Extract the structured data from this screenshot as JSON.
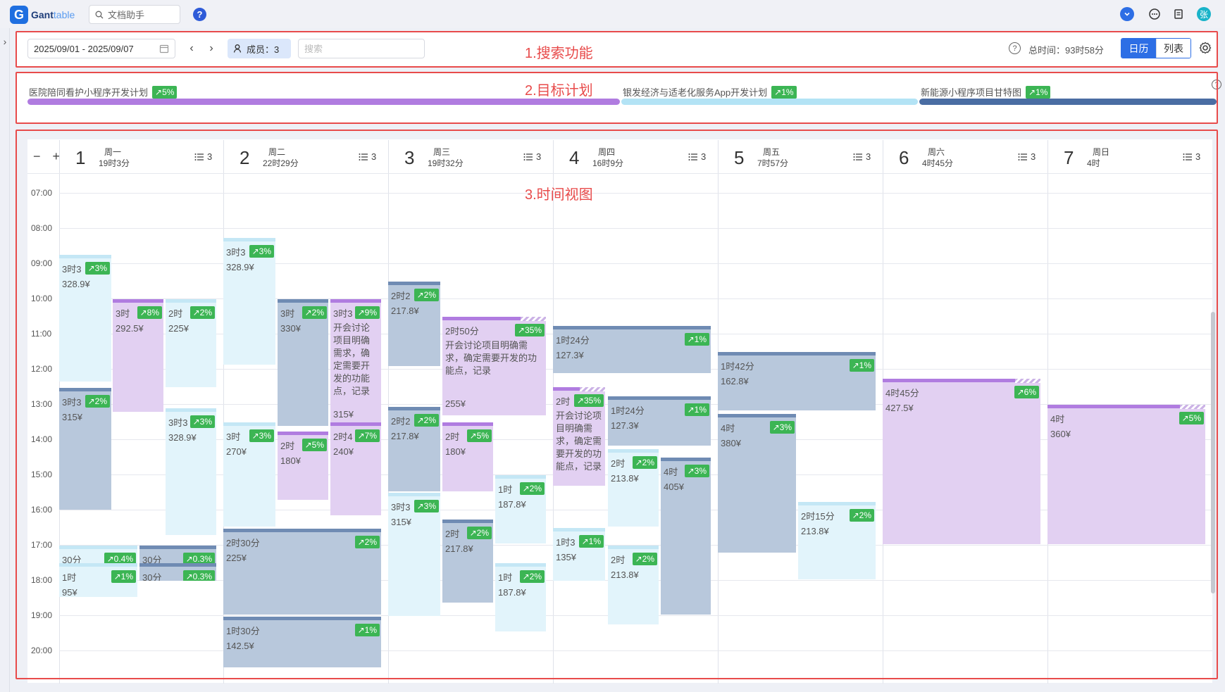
{
  "app": {
    "logo_letter": "G",
    "logo_name_a": "Gant",
    "logo_name_b": "table",
    "doc_search": "文档助手",
    "help": "?",
    "avatar": "张"
  },
  "toolbar": {
    "date_range": "2025/09/01 - 2025/09/07",
    "members_label": "成员：3",
    "search_placeholder": "搜索",
    "total_time": "总时间：93时58分",
    "view_calendar": "日历",
    "view_list": "列表"
  },
  "annotations": {
    "search": "1.搜索功能",
    "goals": "2.目标计划",
    "timeview": "3.时间视图"
  },
  "goals": [
    {
      "name": "医院陪同看护小程序开发计划",
      "pct": "↗5%",
      "color": "#b07ce0"
    },
    {
      "name": "银发经济与适老化服务App开发计划",
      "pct": "↗1%",
      "color": "#b3e3f5"
    },
    {
      "name": "新能源小程序项目甘特图",
      "pct": "↗1%",
      "color": "#4a6da3"
    }
  ],
  "zoom": "− +",
  "days": [
    {
      "num": "1",
      "week": "周一",
      "dur": "19时3分",
      "count": "3"
    },
    {
      "num": "2",
      "week": "周二",
      "dur": "22时29分",
      "count": "3"
    },
    {
      "num": "3",
      "week": "周三",
      "dur": "19时32分",
      "count": "3"
    },
    {
      "num": "4",
      "week": "周四",
      "dur": "16时9分",
      "count": "3"
    },
    {
      "num": "5",
      "week": "周五",
      "dur": "7时57分",
      "count": "3"
    },
    {
      "num": "6",
      "week": "周六",
      "dur": "4时45分",
      "count": "3"
    },
    {
      "num": "7",
      "week": "周日",
      "dur": "4时",
      "count": "3"
    }
  ],
  "hours": [
    "07:00",
    "08:00",
    "09:00",
    "10:00",
    "11:00",
    "12:00",
    "13:00",
    "14:00",
    "15:00",
    "16:00",
    "17:00",
    "18:00",
    "19:00",
    "20:00"
  ],
  "tasks": [
    {
      "style": "t-light",
      "dur": "3时3",
      "pct": "↗3%",
      "cost": "328.9¥"
    },
    {
      "style": "t-purple",
      "dur": "3时",
      "pct": "↗8%",
      "cost": "292.5¥"
    },
    {
      "style": "t-light",
      "dur": "2时",
      "pct": "↗2%",
      "cost": "225¥"
    },
    {
      "style": "t-slate",
      "dur": "3时3",
      "pct": "↗2%",
      "cost": "315¥"
    },
    {
      "style": "t-light",
      "dur": "3时3",
      "pct": "↗3%",
      "cost": "328.9¥"
    },
    {
      "style": "t-light",
      "dur": "30分",
      "pct": "↗0.4%",
      "cost": ""
    },
    {
      "style": "t-slate",
      "dur": "30分",
      "pct": "↗0.3%",
      "cost": ""
    },
    {
      "style": "t-light",
      "dur": "1时",
      "pct": "↗1%",
      "cost": "95¥"
    },
    {
      "style": "t-slate",
      "dur": "30分",
      "pct": "↗0.3%",
      "cost": ""
    },
    {
      "style": "t-light",
      "dur": "3时3",
      "pct": "↗3%",
      "cost": "328.9¥"
    },
    {
      "style": "t-slate",
      "dur": "3时",
      "pct": "↗2%",
      "cost": "330¥"
    },
    {
      "style": "t-purple",
      "dur": "3时3",
      "pct": "↗9%",
      "desc": "开会讨论项目明确需求，确定需要开发的功能点，记录",
      "cost": "315¥"
    },
    {
      "style": "t-light",
      "dur": "3时",
      "pct": "↗3%",
      "cost": "270¥"
    },
    {
      "style": "t-purple",
      "dur": "2时",
      "pct": "↗5%",
      "cost": "180¥"
    },
    {
      "style": "t-purple",
      "dur": "2时4",
      "pct": "↗7%",
      "cost": "240¥"
    },
    {
      "style": "t-slate",
      "dur": "2时30分",
      "pct": "↗2%",
      "cost": "225¥"
    },
    {
      "style": "t-slate",
      "dur": "1时30分",
      "pct": "↗1%",
      "cost": "142.5¥"
    },
    {
      "style": "t-slate",
      "dur": "2时2",
      "pct": "↗2%",
      "cost": "217.8¥"
    },
    {
      "style": "t-purple",
      "dur": "2时50分",
      "pct": "↗35%",
      "desc": "开会讨论项目明确需求，确定需要开发的功能点，记录",
      "cost": "255¥"
    },
    {
      "style": "t-slate",
      "dur": "2时2",
      "pct": "↗2%",
      "cost": "217.8¥"
    },
    {
      "style": "t-purple",
      "dur": "2时",
      "pct": "↗5%",
      "cost": "180¥"
    },
    {
      "style": "t-light",
      "dur": "3时3",
      "pct": "↗3%",
      "cost": "315¥"
    },
    {
      "style": "t-light",
      "dur": "1时",
      "pct": "↗2%",
      "cost": "187.8¥"
    },
    {
      "style": "t-slate",
      "dur": "2时",
      "pct": "↗2%",
      "cost": "217.8¥"
    },
    {
      "style": "t-light",
      "dur": "1时",
      "pct": "↗2%",
      "cost": "187.8¥"
    },
    {
      "style": "t-slate",
      "dur": "1时24分",
      "pct": "↗1%",
      "cost": "127.3¥"
    },
    {
      "style": "t-purple",
      "dur": "2时",
      "pct": "↗35%",
      "desc": "开会讨论项目明确需求，确定需要开发的功能点，记录",
      "cost": ""
    },
    {
      "style": "t-slate",
      "dur": "1时24分",
      "pct": "↗1%",
      "cost": "127.3¥"
    },
    {
      "style": "t-light",
      "dur": "2时",
      "pct": "↗2%",
      "cost": "213.8¥"
    },
    {
      "style": "t-slate",
      "dur": "4时",
      "pct": "↗3%",
      "cost": "405¥"
    },
    {
      "style": "t-light",
      "dur": "1时3",
      "pct": "↗1%",
      "cost": "135¥"
    },
    {
      "style": "t-light",
      "dur": "2时",
      "pct": "↗2%",
      "cost": "213.8¥"
    },
    {
      "style": "t-slate",
      "dur": "1时42分",
      "pct": "↗1%",
      "cost": "162.8¥"
    },
    {
      "style": "t-slate",
      "dur": "4时",
      "pct": "↗3%",
      "cost": "380¥"
    },
    {
      "style": "t-light",
      "dur": "2时15分",
      "pct": "↗2%",
      "cost": "213.8¥"
    },
    {
      "style": "t-purple",
      "dur": "4时45分",
      "pct": "↗6%",
      "cost": "427.5¥"
    },
    {
      "style": "t-purple",
      "dur": "4时",
      "pct": "↗5%",
      "cost": "360¥"
    }
  ]
}
